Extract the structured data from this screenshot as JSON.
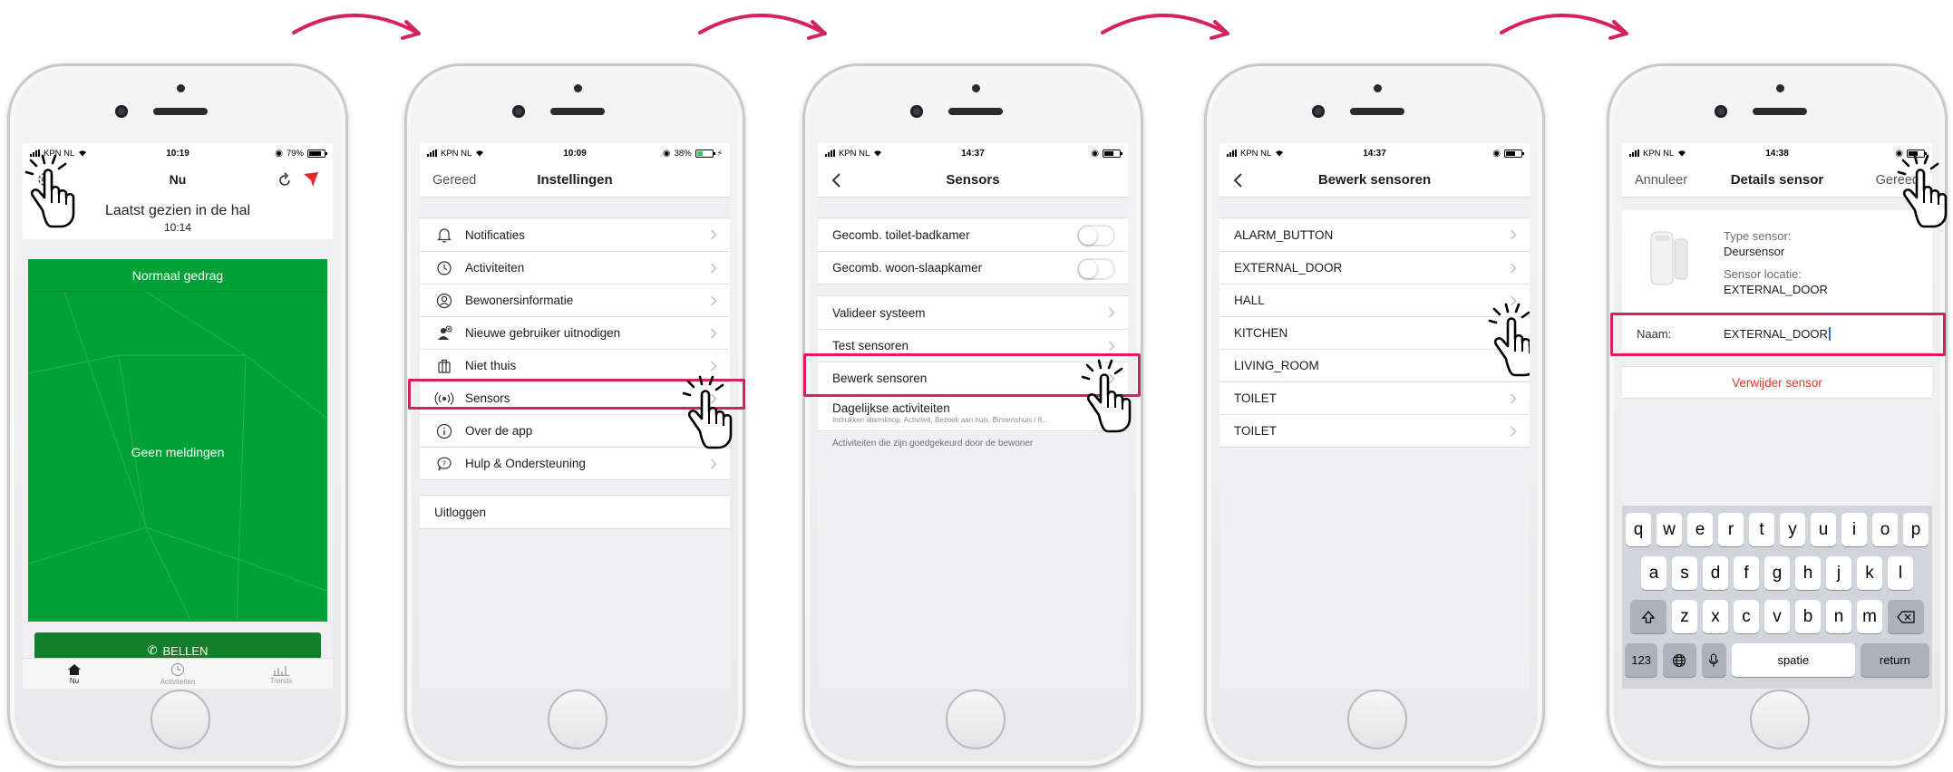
{
  "colors": {
    "accent": "#d6215f",
    "green": "#01a136",
    "call_green": "#12802a",
    "danger": "#e1352b"
  },
  "screens": {
    "s1": {
      "status": {
        "carrier": "KPN NL",
        "time": "10:19",
        "battery": "79%"
      },
      "nav_title": "Nu",
      "last_seen": "Laatst gezien in de hal",
      "last_seen_time": "10:14",
      "card_status": "Normaal gedrag",
      "card_message": "Geen meldingen",
      "call_label": "BELLEN",
      "tabs": [
        {
          "label": "Nu",
          "icon": "home-icon"
        },
        {
          "label": "Activiteiten",
          "icon": "clock-icon"
        },
        {
          "label": "Trends",
          "icon": "bar-chart-icon"
        }
      ]
    },
    "s2": {
      "status": {
        "carrier": "KPN NL",
        "time": "10:09",
        "battery": "38%"
      },
      "left_btn": "Gereed",
      "nav_title": "Instellingen",
      "items": [
        {
          "label": "Notificaties",
          "icon": "bell-icon"
        },
        {
          "label": "Activiteiten",
          "icon": "clock-icon"
        },
        {
          "label": "Bewonersinformatie",
          "icon": "person-icon"
        },
        {
          "label": "Nieuwe gebruiker uitnodigen",
          "icon": "add-person-icon"
        },
        {
          "label": "Niet thuis",
          "icon": "suitcase-icon"
        },
        {
          "label": "Sensors",
          "icon": "sensor-icon"
        },
        {
          "label": "Over de app",
          "icon": "info-icon"
        },
        {
          "label": "Hulp & Ondersteuning",
          "icon": "help-icon"
        }
      ],
      "logout": "Uitloggen"
    },
    "s3": {
      "status": {
        "carrier": "KPN NL",
        "time": "14:37"
      },
      "nav_title": "Sensors",
      "toggles": [
        "Gecomb. toilet-badkamer",
        "Gecomb. woon-slaapkamer"
      ],
      "items": [
        "Valideer systeem",
        "Test sensoren",
        "Bewerk sensoren"
      ],
      "daily_title": "Dagelijkse activiteiten",
      "daily_sub": "Indrukken alarmknop, Activiteit, Bezoek aan huis, Binnenshuis / 8...",
      "footer_note": "Activiteiten die zijn goedgekeurd door de bewoner"
    },
    "s4": {
      "status": {
        "carrier": "KPN NL",
        "time": "14:37"
      },
      "nav_title": "Bewerk sensoren",
      "items": [
        "ALARM_BUTTON",
        "EXTERNAL_DOOR",
        "HALL",
        "KITCHEN",
        "LIVING_ROOM",
        "TOILET",
        "TOILET"
      ]
    },
    "s5": {
      "status": {
        "carrier": "KPN NL",
        "time": "14:38"
      },
      "left_btn": "Annuleer",
      "nav_title": "Details sensor",
      "right_btn": "Gereed",
      "type_label": "Type sensor:",
      "type_value": "Deursensor",
      "location_label": "Sensor locatie:",
      "location_value": "EXTERNAL_DOOR",
      "name_label": "Naam:",
      "name_value": "EXTERNAL_DOOR",
      "delete_label": "Verwijder sensor",
      "keyboard": {
        "row1": [
          "q",
          "w",
          "e",
          "r",
          "t",
          "y",
          "u",
          "i",
          "o",
          "p"
        ],
        "row2": [
          "a",
          "s",
          "d",
          "f",
          "g",
          "h",
          "j",
          "k",
          "l"
        ],
        "row3": [
          "z",
          "x",
          "c",
          "v",
          "b",
          "n",
          "m"
        ],
        "numbers": "123",
        "space": "spatie",
        "return": "return"
      }
    }
  }
}
